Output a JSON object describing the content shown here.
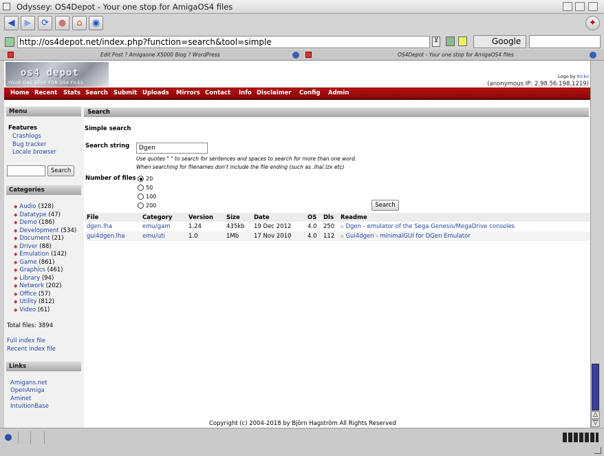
{
  "window": {
    "title": "Odyssey: OS4Depot - Your one stop for AmigaOS4 files"
  },
  "nav": {
    "back_icon": "arrow-left",
    "forward_icon": "arrow-right",
    "reload_icon": "reload",
    "stop_icon": "stop",
    "home_icon": "home",
    "history_icon": "globe"
  },
  "address": {
    "url": "http://os4depot.net/index.php?function=search&tool=simple",
    "search_engine": "Google"
  },
  "tabs": [
    {
      "label": "Edit Post ? Amigaone X5000 Blog ? WordPress"
    },
    {
      "label": "OS4Depot - Your one stop for AmigaOS4 files"
    }
  ],
  "header": {
    "logo_text": "os4 depot",
    "logo_subtitle": "YOUR ONE STOP FOR OS4 FILES",
    "logo_by": "Logo by",
    "logo_author": "Kicko",
    "ip": "(anonymous IP: 2.98.56.198,1219)"
  },
  "menu": [
    "Home",
    "Recent",
    "Stats",
    "Search",
    "Submit",
    "Uploads",
    "Mirrors",
    "Contact",
    "Info",
    "Disclaimer",
    "Config",
    "Admin"
  ],
  "sidebar": {
    "menu_title": "Menu",
    "features_title": "Features",
    "features": [
      "Crashlogs",
      "Bug tracker",
      "Locale browser"
    ],
    "search_button": "Search",
    "categories_title": "Categories",
    "categories": [
      {
        "name": "Audio",
        "count": "(328)"
      },
      {
        "name": "Datatype",
        "count": "(47)"
      },
      {
        "name": "Demo",
        "count": "(186)"
      },
      {
        "name": "Development",
        "count": "(534)"
      },
      {
        "name": "Document",
        "count": "(21)"
      },
      {
        "name": "Driver",
        "count": "(88)"
      },
      {
        "name": "Emulation",
        "count": "(142)"
      },
      {
        "name": "Game",
        "count": "(861)"
      },
      {
        "name": "Graphics",
        "count": "(461)"
      },
      {
        "name": "Library",
        "count": "(94)"
      },
      {
        "name": "Network",
        "count": "(202)"
      },
      {
        "name": "Office",
        "count": "(57)"
      },
      {
        "name": "Utility",
        "count": "(812)"
      },
      {
        "name": "Video",
        "count": "(61)"
      }
    ],
    "total_files": "Total files: 3894",
    "full_index": "Full index file",
    "recent_index": "Recent index file",
    "links_title": "Links",
    "links": [
      "Amigans.net",
      "OpenAmiga",
      "Aminet",
      "IntuitionBase"
    ]
  },
  "search": {
    "heading": "Search",
    "subheading": "Simple search",
    "string_label": "Search string",
    "string_value": "Dgen",
    "hint1": "Use quotes \" \" to search for sentences and spaces to search for more than one word.",
    "hint2": "When searching for filenames don't include the file ending (such as .lha/.lzx etc)",
    "files_label": "Number of files",
    "options": [
      {
        "label": "20",
        "selected": true
      },
      {
        "label": "50",
        "selected": false
      },
      {
        "label": "100",
        "selected": false
      },
      {
        "label": "200",
        "selected": false
      }
    ],
    "button": "Search"
  },
  "results": {
    "columns": [
      "File",
      "Category",
      "Version",
      "Size",
      "Date",
      "OS",
      "Dls",
      "Readme"
    ],
    "rows": [
      {
        "file": "dgen.lha",
        "category": "emu/gam",
        "version": "1.24",
        "size": "435kb",
        "date": "19 Dec 2012",
        "os": "4.0",
        "dls": "250",
        "readme": "Dgen - emulator of the Sega Genesis/MegaDrive consoles"
      },
      {
        "file": "gui4dgen.lha",
        "category": "emu/uti",
        "version": "1.0",
        "size": "1Mb",
        "date": "17 Nov 2010",
        "os": "4.0",
        "dls": "112",
        "readme": "Gui4dgen - minimalGUI for DGen Emulator"
      }
    ]
  },
  "footer": {
    "copyright": "Copyright (c) 2004-2018 by Björn Hagström All Rights Reserved"
  },
  "colors": {
    "menu_red": "#a50d0d",
    "link": "#2046a6"
  }
}
